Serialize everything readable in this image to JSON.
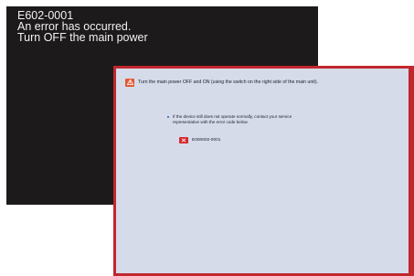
{
  "black_screen": {
    "line1": "E602-0001",
    "line2": "An error has occurred.",
    "line3": "Turn OFF the main power",
    "background_color": "#1c1a1a",
    "text_color": "#f2f2f2"
  },
  "error_panel": {
    "frame_color": "#c0272d",
    "background_color": "#d6dbe9",
    "warning_icon": "warning-icon",
    "message": "Turn the main power OFF and ON (using the switch on the right side of the main unit).",
    "note": "If the device still does not operate normally, contact your service\nrepresentative with the error code below.",
    "code_icon": "service-wrench-icon",
    "error_code": "E000602-0001"
  }
}
